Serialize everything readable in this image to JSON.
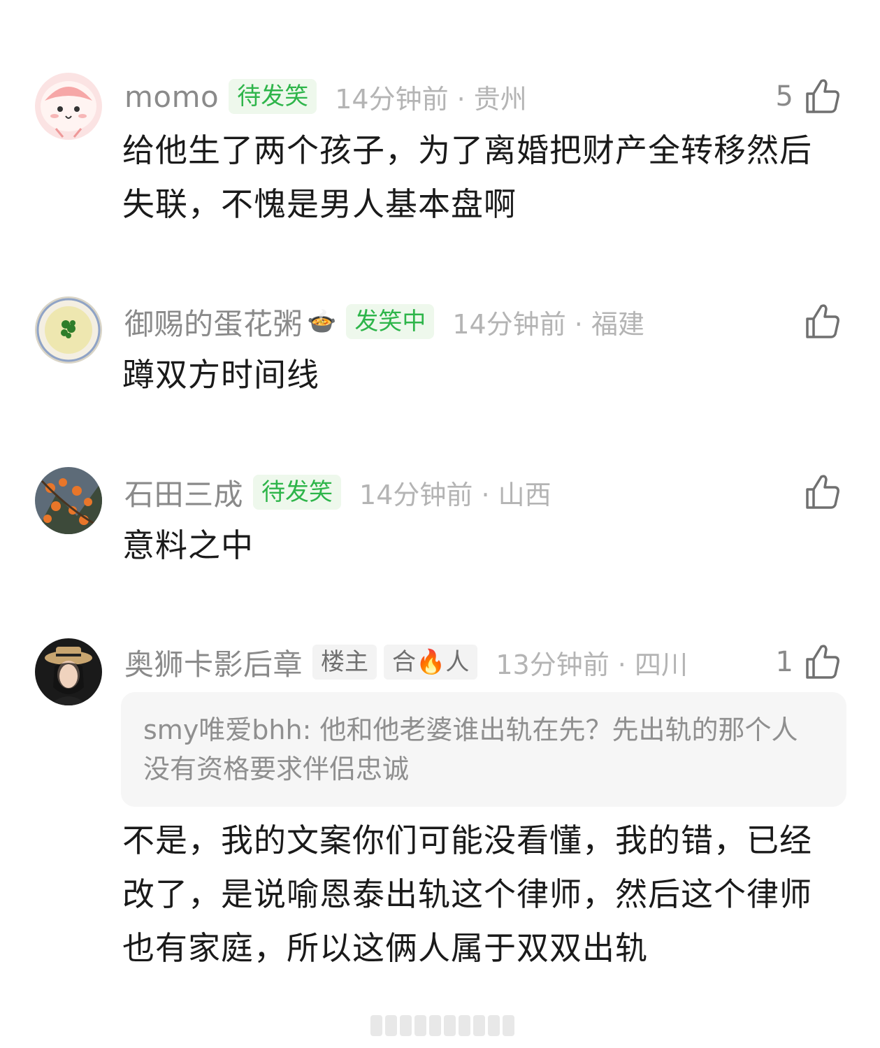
{
  "comments": [
    {
      "username": "momo",
      "badge": "待发笑",
      "time_location": "14分钟前 · 贵州",
      "likes": "5",
      "content": "给他生了两个孩子，为了离婚把财产全转移然后失联，不愧是男人基本盘啊"
    },
    {
      "username": "御赐的蛋花粥",
      "username_emoji": "🍲",
      "badge": "发笑中",
      "time_location": "14分钟前 · 福建",
      "likes": "",
      "content": "蹲双方时间线"
    },
    {
      "username": "石田三成",
      "badge": "待发笑",
      "time_location": "14分钟前 · 山西",
      "likes": "",
      "content": "意料之中"
    },
    {
      "username": "奥狮卡影后章",
      "tag_owner": "楼主",
      "tag_extra": "合🔥人",
      "time_location": "13分钟前 · 四川",
      "likes": "1",
      "quote": "smy唯爱bhh: 他和他老婆谁出轨在先？先出轨的那个人没有资格要求伴侣忠诚",
      "content": "不是，我的文案你们可能没看懂，我的错，已经改了，是说喻恩泰出轨这个律师，然后这个律师也有家庭，所以这俩人属于双双出轨"
    }
  ],
  "colors": {
    "username": "#8a8a8a",
    "badge_green": "#2eb54a",
    "badge_green_bg": "#eef8ec",
    "time": "#b4b4b4",
    "content": "#1a1a1a",
    "quote_bg": "#f6f6f6"
  },
  "icons": [
    "thumbs-up-icon"
  ]
}
